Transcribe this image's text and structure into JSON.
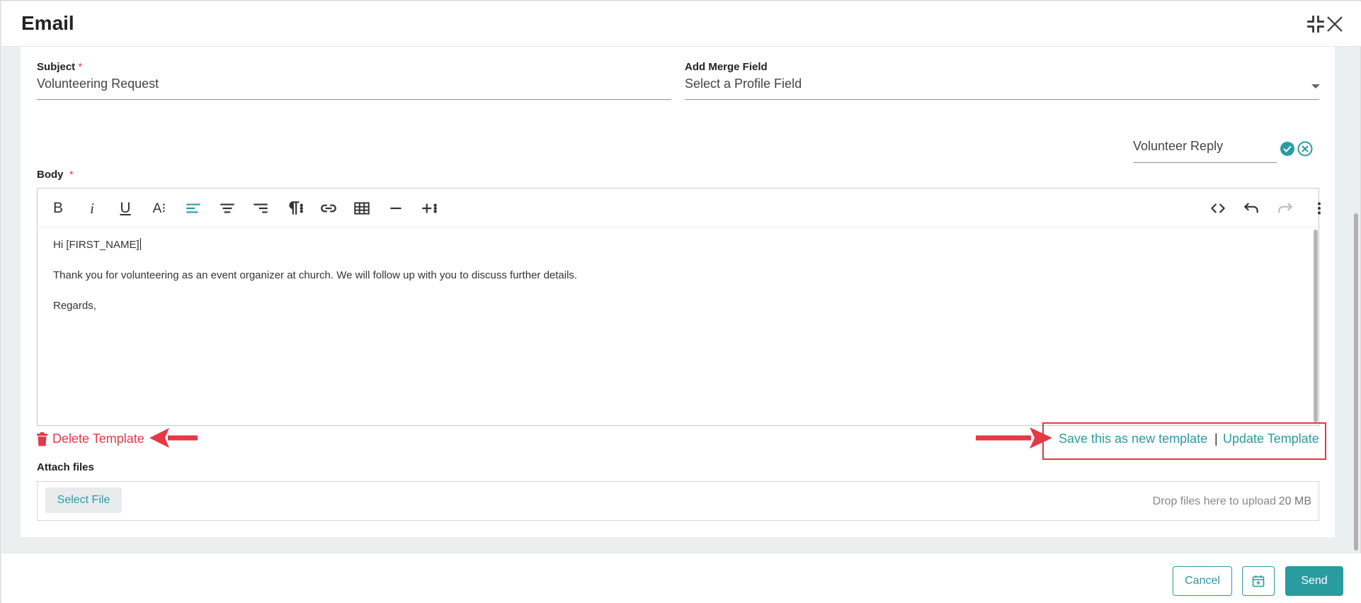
{
  "header": {
    "title": "Email"
  },
  "form": {
    "subject": {
      "label": "Subject",
      "required_mark": "*",
      "value": "Volunteering Request"
    },
    "merge_field": {
      "label": "Add Merge Field",
      "value": "Select a Profile Field"
    },
    "template_name": {
      "value": "Volunteer Reply"
    },
    "body": {
      "label": "Body",
      "required_mark": "*",
      "paragraphs": [
        "Hi [FIRST_NAME]",
        "Thank you for volunteering as an event organizer at church. We will follow up with you to discuss further details.",
        "Regards,"
      ]
    }
  },
  "toolbar": {
    "bold": "B",
    "italic": "i",
    "underline": "U",
    "font_size": "A⁝"
  },
  "template_actions": {
    "delete": "Delete Template",
    "save_new": "Save this as new template",
    "separator": "|",
    "update": "Update Template"
  },
  "attach": {
    "label": "Attach files",
    "button": "Select File",
    "drop_text": "Drop files here to upload",
    "max_size": "20 MB"
  },
  "footer": {
    "cancel": "Cancel",
    "send": "Send"
  },
  "colors": {
    "accent": "#2a9ca0",
    "danger": "#e23a4b",
    "annotation": "#e53945"
  },
  "icons": [
    "collapse-icon",
    "close-icon",
    "check-circle-icon",
    "x-circle-icon",
    "align-left-icon",
    "align-center-icon",
    "align-right-icon",
    "paragraph-icon",
    "link-icon",
    "table-icon",
    "horizontal-line-icon",
    "insert-more-icon",
    "code-view-icon",
    "undo-icon",
    "redo-icon",
    "more-vertical-icon",
    "trash-icon",
    "calendar-icon"
  ]
}
